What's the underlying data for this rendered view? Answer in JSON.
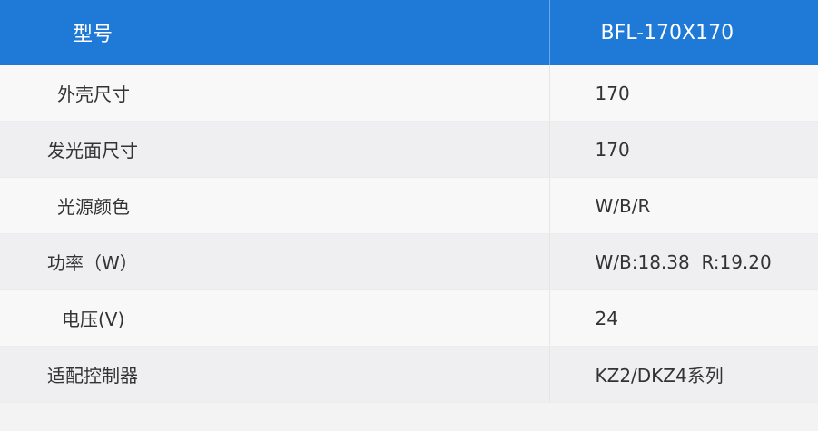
{
  "header": {
    "label": "型号",
    "value": "BFL-170X170"
  },
  "rows": [
    {
      "label": "外壳尺寸",
      "value": "170"
    },
    {
      "label": "发光面尺寸",
      "value": "170"
    },
    {
      "label": "光源颜色",
      "value": "W/B/R"
    },
    {
      "label": "功率（W）",
      "value": "W/B:18.38  R:19.20"
    },
    {
      "label": "电压(V)",
      "value": "24"
    },
    {
      "label": "适配控制器",
      "value": "KZ2/DKZ4系列"
    }
  ]
}
